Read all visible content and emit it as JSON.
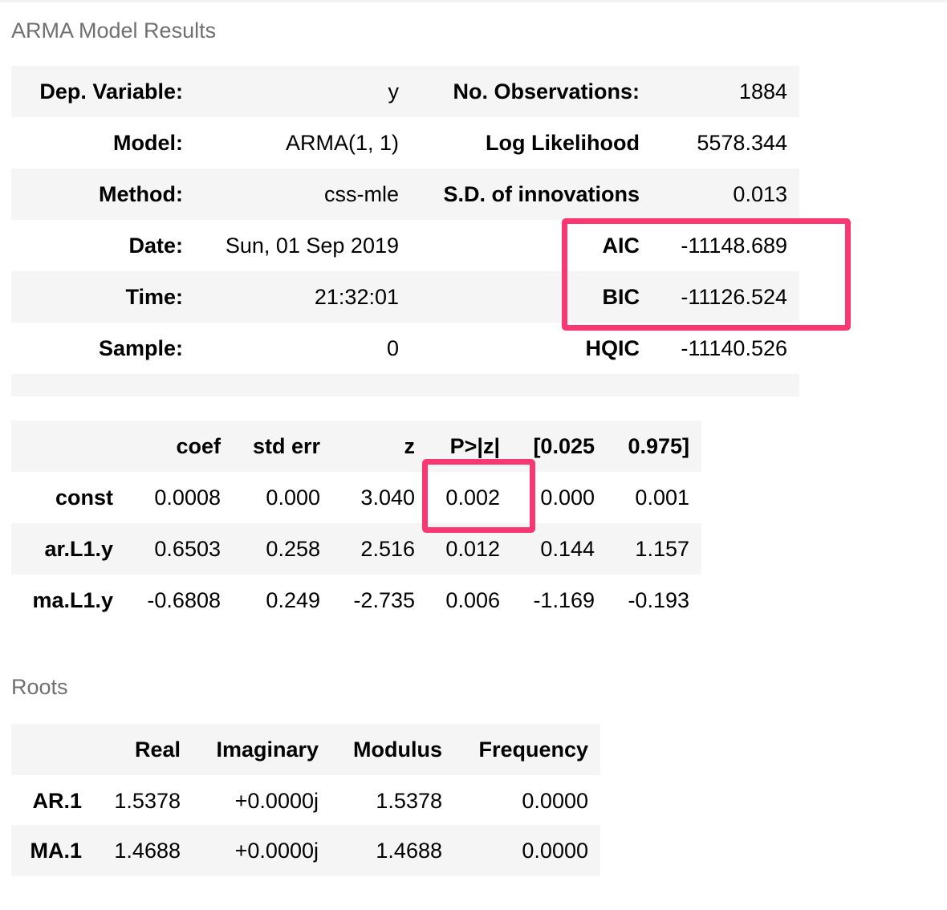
{
  "colors": {
    "highlight": "#f93873",
    "stripe": "#f5f5f5",
    "caption": "#707070"
  },
  "arma_results": {
    "caption": "ARMA Model Results",
    "rows": [
      {
        "label1": "Dep. Variable:",
        "value1": "y",
        "label2": "No. Observations:",
        "value2": "1884"
      },
      {
        "label1": "Model:",
        "value1": "ARMA(1, 1)",
        "label2": "Log Likelihood",
        "value2": "5578.344"
      },
      {
        "label1": "Method:",
        "value1": "css-mle",
        "label2": "S.D. of innovations",
        "value2": "0.013"
      },
      {
        "label1": "Date:",
        "value1": "Sun, 01 Sep 2019",
        "label2": "AIC",
        "value2": "-11148.689"
      },
      {
        "label1": "Time:",
        "value1": "21:32:01",
        "label2": "BIC",
        "value2": "-11126.524"
      },
      {
        "label1": "Sample:",
        "value1": "0",
        "label2": "HQIC",
        "value2": "-11140.526"
      }
    ]
  },
  "coef_table": {
    "headers": [
      "",
      "coef",
      "std err",
      "z",
      "P>|z|",
      "[0.025",
      "0.975]"
    ],
    "rows": [
      {
        "name": "const",
        "coef": "0.0008",
        "std_err": "0.000",
        "z": "3.040",
        "p": "0.002",
        "lo": "0.000",
        "hi": "0.001"
      },
      {
        "name": "ar.L1.y",
        "coef": "0.6503",
        "std_err": "0.258",
        "z": "2.516",
        "p": "0.012",
        "lo": "0.144",
        "hi": "1.157"
      },
      {
        "name": "ma.L1.y",
        "coef": "-0.6808",
        "std_err": "0.249",
        "z": "-2.735",
        "p": "0.006",
        "lo": "-1.169",
        "hi": "-0.193"
      }
    ]
  },
  "roots": {
    "caption": "Roots",
    "headers": [
      "",
      "Real",
      "Imaginary",
      "Modulus",
      "Frequency"
    ],
    "rows": [
      {
        "name": "AR.1",
        "real": "1.5378",
        "imag": "+0.0000j",
        "modulus": "1.5378",
        "freq": "0.0000"
      },
      {
        "name": "MA.1",
        "real": "1.4688",
        "imag": "+0.0000j",
        "modulus": "1.4688",
        "freq": "0.0000"
      }
    ]
  }
}
